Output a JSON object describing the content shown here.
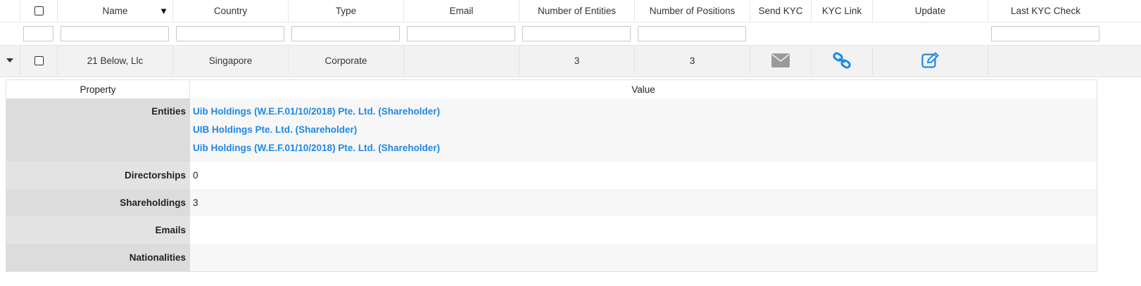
{
  "columns": {
    "name": "Name",
    "country": "Country",
    "type": "Type",
    "email": "Email",
    "num_entities": "Number of Entities",
    "num_positions": "Number of Positions",
    "send_kyc": "Send KYC",
    "kyc_link": "KYC Link",
    "update": "Update",
    "last_kyc_check": "Last KYC Check"
  },
  "sort": {
    "column": "Name",
    "indicator": "▼"
  },
  "row": {
    "name": "21 Below, Llc",
    "country": "Singapore",
    "type": "Corporate",
    "email": "",
    "num_entities": "3",
    "num_positions": "3",
    "last_kyc_check": "",
    "icons": {
      "send_kyc": "envelope-icon",
      "kyc_link": "link-icon",
      "update": "edit-icon"
    }
  },
  "detail": {
    "header": {
      "property": "Property",
      "value": "Value"
    },
    "entities_label": "Entities",
    "entities": [
      "Uib Holdings (W.E.F.01/10/2018) Pte. Ltd. (Shareholder)",
      "UIB Holdings Pte. Ltd. (Shareholder)",
      "Uib Holdings (W.E.F.01/10/2018) Pte. Ltd. (Shareholder)"
    ],
    "directorships_label": "Directorships",
    "directorships": "0",
    "shareholdings_label": "Shareholdings",
    "shareholdings": "3",
    "emails_label": "Emails",
    "emails": "",
    "nationalities_label": "Nationalities",
    "nationalities": ""
  },
  "colors": {
    "link": "#1e88e5",
    "icon_gray": "#9a9a9a",
    "row_bg": "#f2f2f2",
    "key_bg": "#dcdcdc"
  }
}
